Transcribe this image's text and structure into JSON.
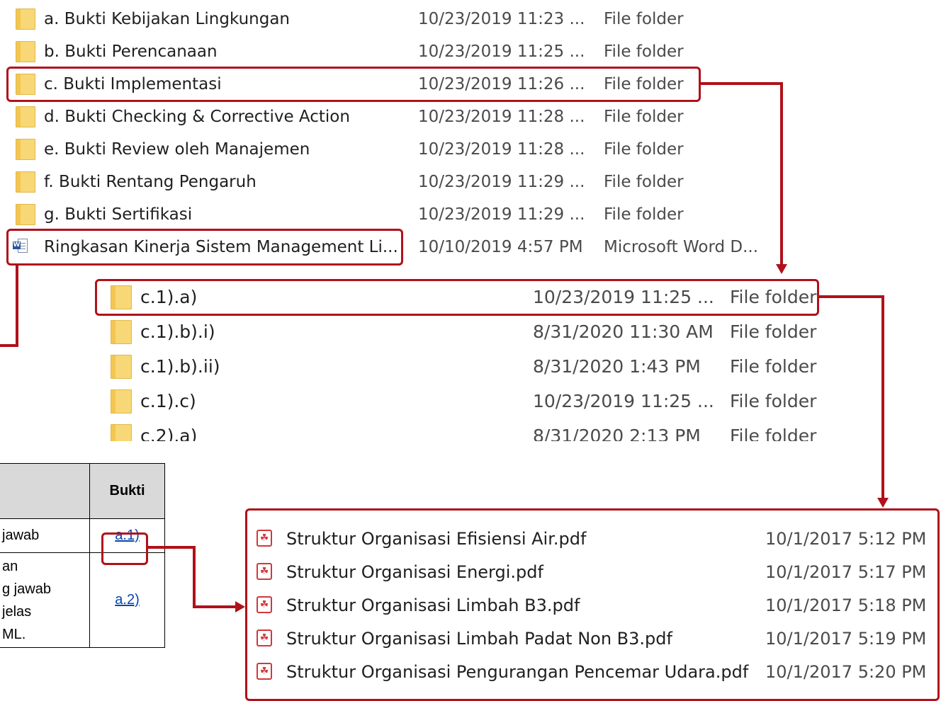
{
  "top_list": {
    "rows": [
      {
        "name": "a. Bukti Kebijakan Lingkungan",
        "date": "10/23/2019 11:23 ...",
        "type": "File folder",
        "icon": "folder-icon"
      },
      {
        "name": "b. Bukti Perencanaan",
        "date": "10/23/2019 11:25 ...",
        "type": "File folder",
        "icon": "folder-icon"
      },
      {
        "name": "c. Bukti Implementasi",
        "date": "10/23/2019 11:26 ...",
        "type": "File folder",
        "icon": "folder-icon"
      },
      {
        "name": "d. Bukti Checking & Corrective Action",
        "date": "10/23/2019 11:28 ...",
        "type": "File folder",
        "icon": "folder-icon"
      },
      {
        "name": "e. Bukti Review oleh Manajemen",
        "date": "10/23/2019 11:28 ...",
        "type": "File folder",
        "icon": "folder-icon"
      },
      {
        "name": "f. Bukti Rentang Pengaruh",
        "date": "10/23/2019 11:29 ...",
        "type": "File folder",
        "icon": "folder-icon"
      },
      {
        "name": "g. Bukti Sertifikasi",
        "date": "10/23/2019 11:29 ...",
        "type": "File folder",
        "icon": "folder-icon"
      },
      {
        "name": "Ringkasan Kinerja Sistem Management Li...",
        "date": "10/10/2019 4:57 PM",
        "type": "Microsoft Word D...",
        "icon": "word-doc-icon"
      }
    ]
  },
  "sub_list": {
    "rows": [
      {
        "name": "c.1).a)",
        "date": "10/23/2019 11:25 ...",
        "type": "File folder",
        "icon": "folder-icon"
      },
      {
        "name": "c.1).b).i)",
        "date": "8/31/2020 11:30 AM",
        "type": "File folder",
        "icon": "folder-icon"
      },
      {
        "name": "c.1).b).ii)",
        "date": "8/31/2020 1:43 PM",
        "type": "File folder",
        "icon": "folder-icon"
      },
      {
        "name": "c.1).c)",
        "date": "10/23/2019 11:25 ...",
        "type": "File folder",
        "icon": "folder-icon"
      },
      {
        "name": "c.2).a)",
        "date": "8/31/2020 2:13 PM",
        "type": "File folder",
        "icon": "folder-icon"
      }
    ]
  },
  "pdf_list": {
    "rows": [
      {
        "name": "Struktur Organisasi Efisiensi Air.pdf",
        "date": "10/1/2017 5:12 PM",
        "icon": "pdf-icon"
      },
      {
        "name": "Struktur Organisasi Energi.pdf",
        "date": "10/1/2017 5:17 PM",
        "icon": "pdf-icon"
      },
      {
        "name": "Struktur Organisasi Limbah B3.pdf",
        "date": "10/1/2017 5:18 PM",
        "icon": "pdf-icon"
      },
      {
        "name": "Struktur Organisasi Limbah Padat Non B3.pdf",
        "date": "10/1/2017 5:19 PM",
        "icon": "pdf-icon"
      },
      {
        "name": "Struktur Organisasi Pengurangan Pencemar Udara.pdf",
        "date": "10/1/2017 5:20 PM",
        "icon": "pdf-icon"
      }
    ]
  },
  "doc_table": {
    "header_bukti": "Bukti",
    "rows": [
      {
        "text_lines": [
          "jawab"
        ],
        "link": "a.1)"
      },
      {
        "text_lines": [
          "an",
          "g jawab",
          "jelas",
          "ML."
        ],
        "link": "a.2)"
      }
    ]
  },
  "colors": {
    "highlight": "#b0111b",
    "folder": "#f8d776",
    "link": "#0645ad",
    "header_bg": "#d9d9d9"
  }
}
